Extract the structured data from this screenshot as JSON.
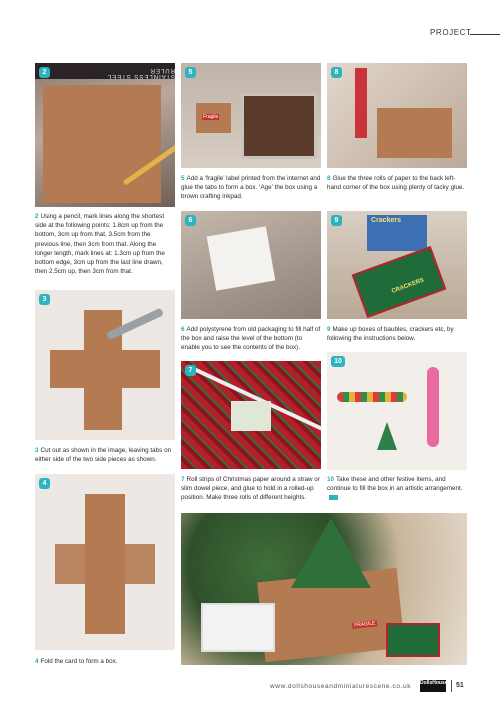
{
  "header": {
    "section": "PROJECT"
  },
  "steps": {
    "s2": {
      "num": "2",
      "text": "Using a pencil, mark lines along the shortest side at the following points: 1.8cm up from the bottom, 3cm up from that, 3.5cm from the previous line, then 3cm from that. Along the longer length, mark lines at: 1.3cm up from the bottom edge, 3cm up from the last line drawn, then 2.5cm up, then 3cm from that."
    },
    "s3": {
      "num": "3",
      "text": "Cut out as shown in the image, leaving tabs on either side of the two side pieces as shown."
    },
    "s4": {
      "num": "4",
      "text": "Fold the card to form a box."
    },
    "s5": {
      "num": "5",
      "text": "Add a ‘fragile’ label printed from the internet and glue the tabs to form a box. ‘Age’ the box using a brown crafting inkpad."
    },
    "s6": {
      "num": "6",
      "text": "Add polystyrene from old packaging to fill half of the box and raise the level of the bottom (to enable you to see the contents of the box)."
    },
    "s7": {
      "num": "7",
      "text": "Roll strips of Christmas paper around a straw or slim dowel piece, and glue to hold in a rolled-up position. Make three rolls of different heights."
    },
    "s8": {
      "num": "8",
      "text": "Glue the three rolls of paper to the back left-hand corner of the box using plenty of tacky glue."
    },
    "s9": {
      "num": "9",
      "text": "Make up boxes of baubles, crackers etc, by following the instructions below."
    },
    "s10": {
      "num": "10",
      "text": "Take these and other festive items, and continue to fill the box in an artistic arrangement."
    }
  },
  "photo_text": {
    "ruler": "STAINLESS STEEL RULER",
    "crackers_top": "Crackers",
    "crackers_box": "CRACKERS",
    "fragile": "Fragile",
    "fragile_box": "FRAGILE"
  },
  "footer": {
    "website": "www.dollshouseandminiaturescene.co.uk",
    "brand": "DollsHouse",
    "page": "51"
  },
  "colors": {
    "accent": "#2bb3c0",
    "kraft": "#b47a52",
    "text": "#2b2b2b"
  }
}
